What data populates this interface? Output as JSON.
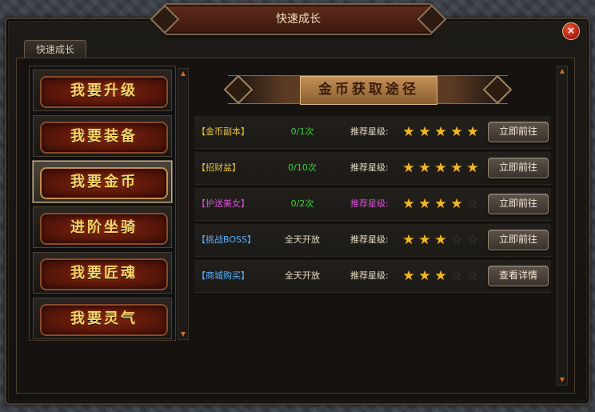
{
  "window": {
    "title": "快速成长",
    "close_label": "×"
  },
  "tab": {
    "label": "快速成长"
  },
  "left_menu": [
    {
      "label": "我要升级",
      "active": false
    },
    {
      "label": "我要装备",
      "active": false
    },
    {
      "label": "我要金币",
      "active": true
    },
    {
      "label": "进阶坐骑",
      "active": false
    },
    {
      "label": "我要匠魂",
      "active": false
    },
    {
      "label": "我要灵气",
      "active": false
    }
  ],
  "right": {
    "section_title": "金币获取途径",
    "rows": [
      {
        "name": "【金币副本】",
        "name_color": "#e7c23b",
        "progress": "0/1次",
        "progress_color": "#3fd13f",
        "rec_label": "推荐星级:",
        "rec_color": "#e8dcc4",
        "stars": 5,
        "action": "立即前往"
      },
      {
        "name": "【招财盆】",
        "name_color": "#e7c23b",
        "progress": "0/10次",
        "progress_color": "#3fd13f",
        "rec_label": "推荐星级:",
        "rec_color": "#e8dcc4",
        "stars": 5,
        "action": "立即前往"
      },
      {
        "name": "【护送美女】",
        "name_color": "#d94fd9",
        "progress": "0/2次",
        "progress_color": "#3fd13f",
        "rec_label": "推荐星级:",
        "rec_color": "#d94fd9",
        "stars": 4,
        "action": "立即前往"
      },
      {
        "name": "【挑战BOSS】",
        "name_color": "#5ab2ff",
        "progress": "全天开放",
        "progress_color": "#e8dcc4",
        "rec_label": "推荐星级:",
        "rec_color": "#e8dcc4",
        "stars": 3,
        "action": "立即前往"
      },
      {
        "name": "【商城购买】",
        "name_color": "#5ab2ff",
        "progress": "全天开放",
        "progress_color": "#e8dcc4",
        "rec_label": "推荐星级:",
        "rec_color": "#e8dcc4",
        "stars": 3,
        "action": "查看详情"
      }
    ],
    "max_stars": 5
  }
}
